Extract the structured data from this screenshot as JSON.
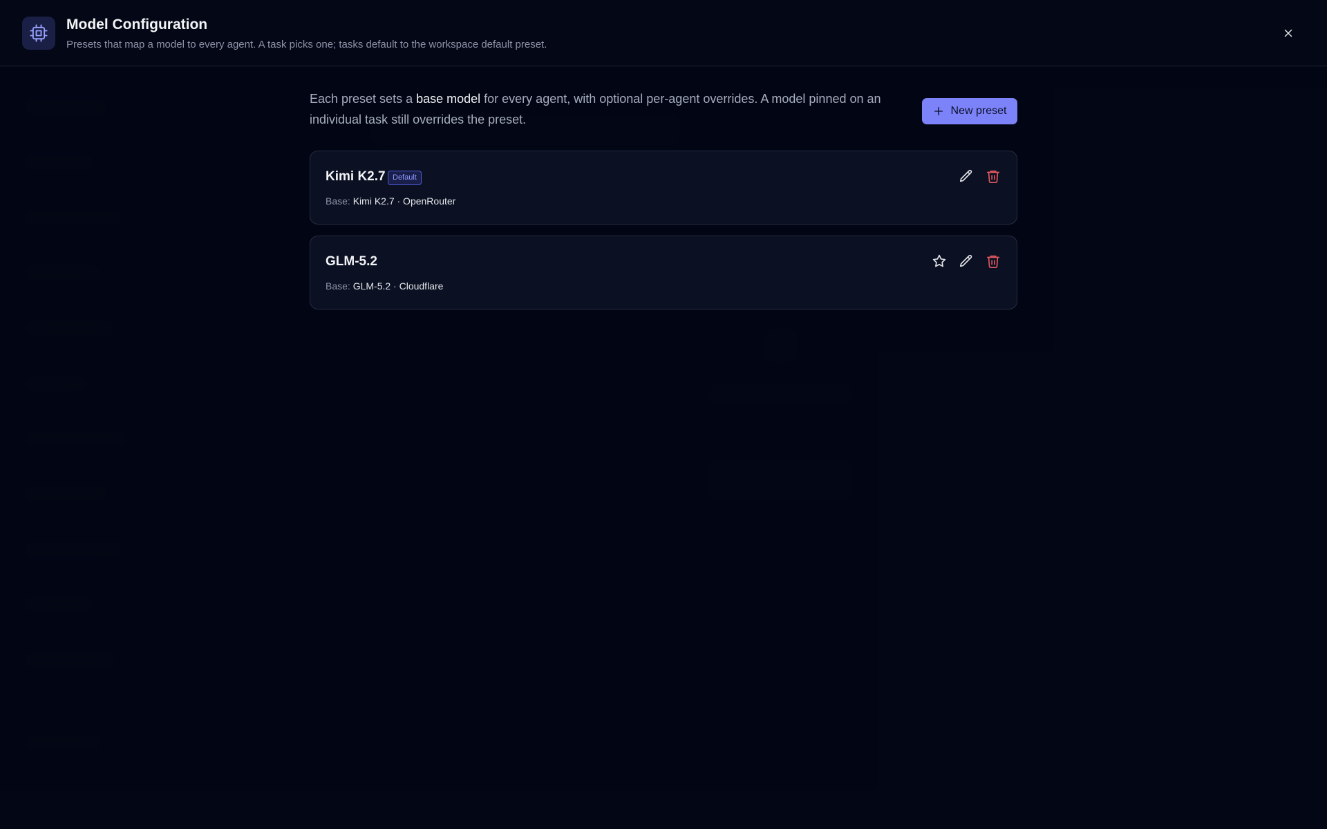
{
  "header": {
    "title": "Model Configuration",
    "subtitle": "Presets that map a model to every agent. A task picks one; tasks default to the workspace default preset.",
    "icon": "cpu-icon",
    "close_icon": "close-icon"
  },
  "intro": {
    "text_before": "Each preset sets a ",
    "emphasis": "base model",
    "text_after": " for every agent, with optional per-agent overrides. A model pinned on an individual task still overrides the preset."
  },
  "new_preset_button": {
    "label": "New preset",
    "icon": "plus-icon"
  },
  "presets": [
    {
      "name": "Kimi K2.7",
      "badge": "Default",
      "base_label": "Base:",
      "base_value": "Kimi K2.7 · OpenRouter",
      "actions": [
        "edit-icon",
        "trash-icon"
      ]
    },
    {
      "name": "GLM-5.2",
      "badge": "",
      "base_label": "Base:",
      "base_value": "GLM-5.2 · Cloudflare",
      "actions": [
        "star-icon",
        "edit-icon",
        "trash-icon"
      ]
    }
  ],
  "colors": {
    "background": "#050816",
    "accent": "#7c83f8",
    "badge_text": "#8e98ff",
    "danger": "#e0595f",
    "card_border": "#252d42"
  }
}
